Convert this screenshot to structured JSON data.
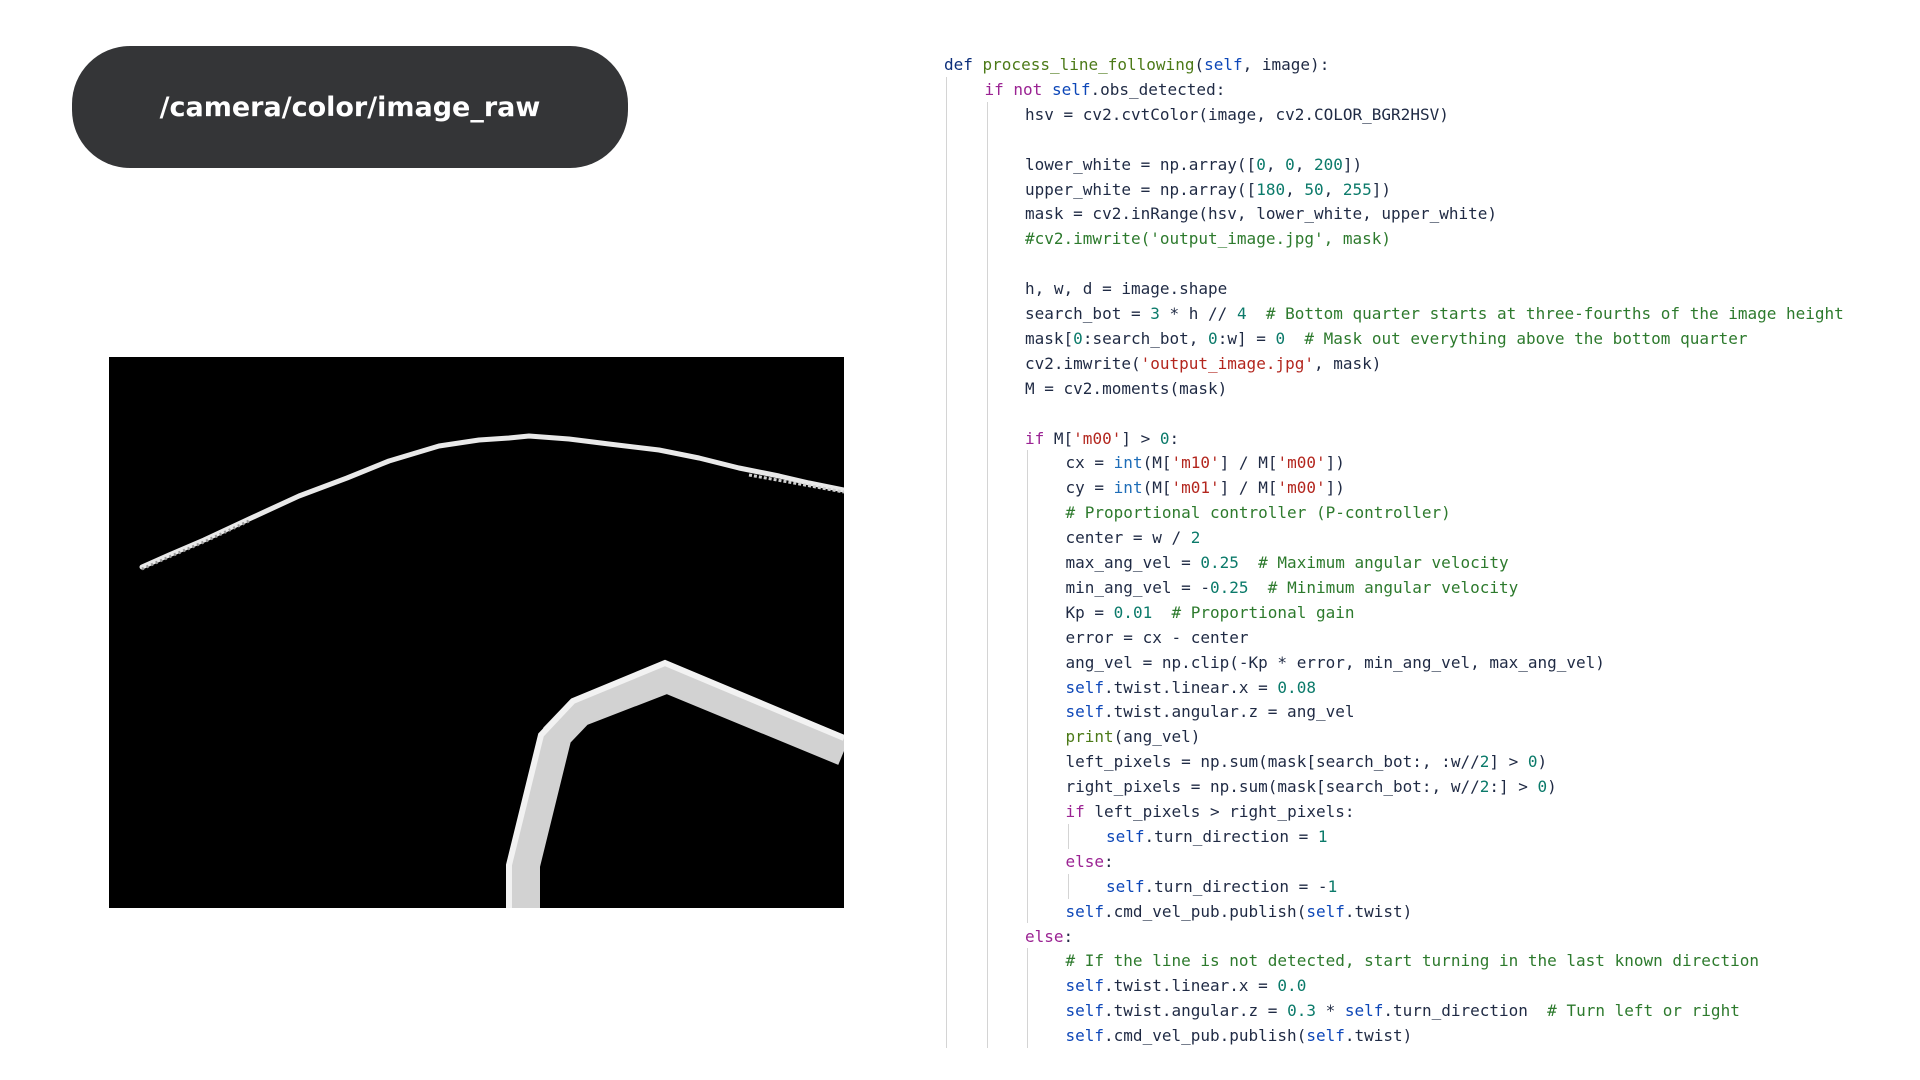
{
  "topic": "/camera/color/image_raw",
  "code_lines": [
    {
      "indent": 0,
      "tokens": [
        [
          "kw",
          "def "
        ],
        [
          "fn",
          "process_line_following"
        ],
        [
          "p",
          "("
        ],
        [
          "self",
          "self"
        ],
        [
          "p",
          ", image):"
        ]
      ]
    },
    {
      "indent": 1,
      "tokens": [
        [
          "kw2",
          "if "
        ],
        [
          "kw2",
          "not "
        ],
        [
          "self",
          "self"
        ],
        [
          "p",
          ".obs_detected:"
        ]
      ]
    },
    {
      "indent": 2,
      "tokens": [
        [
          "p",
          "hsv = cv2.cvtColor(image, cv2.COLOR_BGR2HSV)"
        ]
      ]
    },
    {
      "indent": 2,
      "tokens": []
    },
    {
      "indent": 2,
      "tokens": [
        [
          "p",
          "lower_white = np.array(["
        ],
        [
          "num",
          "0"
        ],
        [
          "p",
          ", "
        ],
        [
          "num",
          "0"
        ],
        [
          "p",
          ", "
        ],
        [
          "num",
          "200"
        ],
        [
          "p",
          "])"
        ]
      ]
    },
    {
      "indent": 2,
      "tokens": [
        [
          "p",
          "upper_white = np.array(["
        ],
        [
          "num",
          "180"
        ],
        [
          "p",
          ", "
        ],
        [
          "num",
          "50"
        ],
        [
          "p",
          ", "
        ],
        [
          "num",
          "255"
        ],
        [
          "p",
          "])"
        ]
      ]
    },
    {
      "indent": 2,
      "tokens": [
        [
          "p",
          "mask = cv2.inRange(hsv, lower_white, upper_white)"
        ]
      ]
    },
    {
      "indent": 2,
      "tokens": [
        [
          "cm",
          "#cv2.imwrite('output_image.jpg', mask)"
        ]
      ]
    },
    {
      "indent": 2,
      "tokens": []
    },
    {
      "indent": 2,
      "tokens": [
        [
          "p",
          "h, w, d = image.shape"
        ]
      ]
    },
    {
      "indent": 2,
      "tokens": [
        [
          "p",
          "search_bot = "
        ],
        [
          "num",
          "3"
        ],
        [
          "p",
          " * h // "
        ],
        [
          "num",
          "4"
        ],
        [
          "p",
          "  "
        ],
        [
          "cm",
          "# Bottom quarter starts at three-fourths of the image height"
        ]
      ]
    },
    {
      "indent": 2,
      "tokens": [
        [
          "p",
          "mask["
        ],
        [
          "num",
          "0"
        ],
        [
          "p",
          ":search_bot, "
        ],
        [
          "num",
          "0"
        ],
        [
          "p",
          ":w] = "
        ],
        [
          "num",
          "0"
        ],
        [
          "p",
          "  "
        ],
        [
          "cm",
          "# Mask out everything above the bottom quarter"
        ]
      ]
    },
    {
      "indent": 2,
      "tokens": [
        [
          "p",
          "cv2.imwrite("
        ],
        [
          "str",
          "'output_image.jpg'"
        ],
        [
          "p",
          ", mask)"
        ]
      ]
    },
    {
      "indent": 2,
      "tokens": [
        [
          "p",
          "M = cv2.moments(mask)"
        ]
      ]
    },
    {
      "indent": 2,
      "tokens": []
    },
    {
      "indent": 2,
      "tokens": [
        [
          "kw2",
          "if "
        ],
        [
          "p",
          "M["
        ],
        [
          "str",
          "'m00'"
        ],
        [
          "p",
          "] > "
        ],
        [
          "num",
          "0"
        ],
        [
          "p",
          ":"
        ]
      ]
    },
    {
      "indent": 3,
      "tokens": [
        [
          "p",
          "cx = "
        ],
        [
          "bi",
          "int"
        ],
        [
          "p",
          "(M["
        ],
        [
          "str",
          "'m10'"
        ],
        [
          "p",
          "] / M["
        ],
        [
          "str",
          "'m00'"
        ],
        [
          "p",
          "])"
        ]
      ]
    },
    {
      "indent": 3,
      "tokens": [
        [
          "p",
          "cy = "
        ],
        [
          "bi",
          "int"
        ],
        [
          "p",
          "(M["
        ],
        [
          "str",
          "'m01'"
        ],
        [
          "p",
          "] / M["
        ],
        [
          "str",
          "'m00'"
        ],
        [
          "p",
          "])"
        ]
      ]
    },
    {
      "indent": 3,
      "tokens": [
        [
          "cm",
          "# Proportional controller (P-controller)"
        ]
      ]
    },
    {
      "indent": 3,
      "tokens": [
        [
          "p",
          "center = w / "
        ],
        [
          "num",
          "2"
        ]
      ]
    },
    {
      "indent": 3,
      "tokens": [
        [
          "p",
          "max_ang_vel = "
        ],
        [
          "num",
          "0.25"
        ],
        [
          "p",
          "  "
        ],
        [
          "cm",
          "# Maximum angular velocity"
        ]
      ]
    },
    {
      "indent": 3,
      "tokens": [
        [
          "p",
          "min_ang_vel = -"
        ],
        [
          "num",
          "0.25"
        ],
        [
          "p",
          "  "
        ],
        [
          "cm",
          "# Minimum angular velocity"
        ]
      ]
    },
    {
      "indent": 3,
      "tokens": [
        [
          "p",
          "Kp = "
        ],
        [
          "num",
          "0.01"
        ],
        [
          "p",
          "  "
        ],
        [
          "cm",
          "# Proportional gain"
        ]
      ]
    },
    {
      "indent": 3,
      "tokens": [
        [
          "p",
          "error = cx - center"
        ]
      ]
    },
    {
      "indent": 3,
      "tokens": [
        [
          "p",
          "ang_vel = np.clip(-Kp * error, min_ang_vel, max_ang_vel)"
        ]
      ]
    },
    {
      "indent": 3,
      "tokens": [
        [
          "self",
          "self"
        ],
        [
          "p",
          ".twist.linear.x = "
        ],
        [
          "num",
          "0.08"
        ]
      ]
    },
    {
      "indent": 3,
      "tokens": [
        [
          "self",
          "self"
        ],
        [
          "p",
          ".twist.angular.z = ang_vel"
        ]
      ]
    },
    {
      "indent": 3,
      "tokens": [
        [
          "fn",
          "print"
        ],
        [
          "p",
          "(ang_vel)"
        ]
      ]
    },
    {
      "indent": 3,
      "tokens": [
        [
          "p",
          "left_pixels = np.sum(mask[search_bot:, :w//"
        ],
        [
          "num",
          "2"
        ],
        [
          "p",
          "] > "
        ],
        [
          "num",
          "0"
        ],
        [
          "p",
          ")"
        ]
      ]
    },
    {
      "indent": 3,
      "tokens": [
        [
          "p",
          "right_pixels = np.sum(mask[search_bot:, w//"
        ],
        [
          "num",
          "2"
        ],
        [
          "p",
          ":] > "
        ],
        [
          "num",
          "0"
        ],
        [
          "p",
          ")"
        ]
      ]
    },
    {
      "indent": 3,
      "tokens": [
        [
          "kw2",
          "if "
        ],
        [
          "p",
          "left_pixels > right_pixels:"
        ]
      ]
    },
    {
      "indent": 4,
      "tokens": [
        [
          "self",
          "self"
        ],
        [
          "p",
          ".turn_direction = "
        ],
        [
          "num",
          "1"
        ]
      ]
    },
    {
      "indent": 3,
      "tokens": [
        [
          "kw2",
          "else"
        ],
        [
          "p",
          ":"
        ]
      ]
    },
    {
      "indent": 4,
      "tokens": [
        [
          "self",
          "self"
        ],
        [
          "p",
          ".turn_direction = -"
        ],
        [
          "num",
          "1"
        ]
      ]
    },
    {
      "indent": 3,
      "tokens": [
        [
          "self",
          "self"
        ],
        [
          "p",
          ".cmd_vel_pub.publish("
        ],
        [
          "self",
          "self"
        ],
        [
          "p",
          ".twist)"
        ]
      ]
    },
    {
      "indent": 2,
      "tokens": [
        [
          "kw2",
          "else"
        ],
        [
          "p",
          ":"
        ]
      ]
    },
    {
      "indent": 3,
      "tokens": [
        [
          "cm",
          "# If the line is not detected, start turning in the last known direction"
        ]
      ]
    },
    {
      "indent": 3,
      "tokens": [
        [
          "self",
          "self"
        ],
        [
          "p",
          ".twist.linear.x = "
        ],
        [
          "num",
          "0.0"
        ]
      ]
    },
    {
      "indent": 3,
      "tokens": [
        [
          "self",
          "self"
        ],
        [
          "p",
          ".twist.angular.z = "
        ],
        [
          "num",
          "0.3"
        ],
        [
          "p",
          " * "
        ],
        [
          "self",
          "self"
        ],
        [
          "p",
          ".turn_direction  "
        ],
        [
          "cm",
          "# Turn left or right"
        ]
      ]
    },
    {
      "indent": 3,
      "tokens": [
        [
          "self",
          "self"
        ],
        [
          "p",
          ".cmd_vel_pub.publish("
        ],
        [
          "self",
          "self"
        ],
        [
          "p",
          ".twist)"
        ]
      ]
    }
  ]
}
